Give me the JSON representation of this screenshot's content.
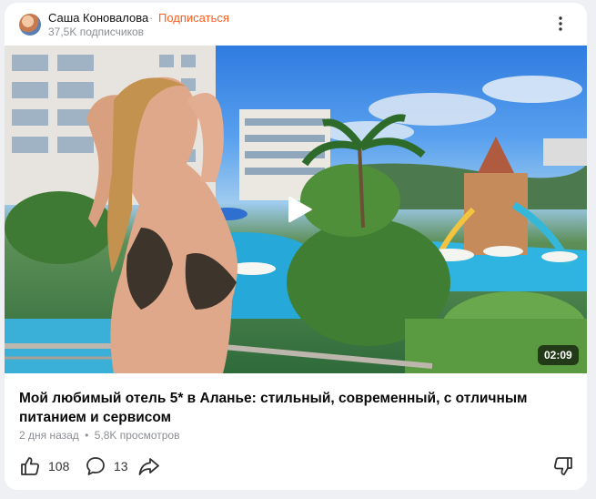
{
  "channel": {
    "name": "Саша Коновалова",
    "separator": "·",
    "subscribe_label": "Подписаться",
    "subscribers": "37,5K подписчиков"
  },
  "video": {
    "duration": "02:09",
    "title": "Мой любимый отель 5* в Аланье: стильный, современный, с отличным питанием и сервисом"
  },
  "meta": {
    "posted": "2 дня назад",
    "dot": "•",
    "views": "5,8K просмотров"
  },
  "actions": {
    "likes": "108",
    "comments": "13"
  },
  "icons": {
    "menu": "more-vertical-icon",
    "play": "play-icon",
    "like": "thumbs-up-icon",
    "comment": "comment-bubble-icon",
    "share": "share-arrow-icon",
    "dislike": "thumbs-down-icon"
  },
  "colors": {
    "accent": "#ff5b1f",
    "muted": "#8b8e93"
  }
}
